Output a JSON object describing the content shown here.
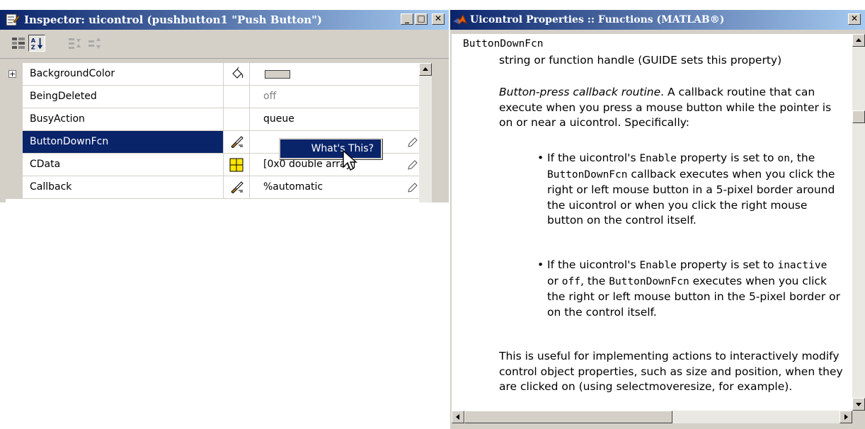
{
  "inspector": {
    "title": "Inspector: uicontrol (pushbutton1 \"Push Button\")",
    "minimize_label": "_",
    "maximize_label": "□",
    "close_label": "✕",
    "expand_label": "+",
    "rows": [
      {
        "name": "BackgroundColor",
        "value": ""
      },
      {
        "name": "BeingDeleted",
        "value": "off"
      },
      {
        "name": "BusyAction",
        "value": "queue"
      },
      {
        "name": "ButtonDownFcn",
        "value": ""
      },
      {
        "name": "CData",
        "value": "[0x0 double array]"
      },
      {
        "name": "Callback",
        "value": "%automatic"
      }
    ],
    "context_menu_item": "What's This?"
  },
  "help": {
    "title": "Uicontrol Properties :: Functions (MATLAB®)",
    "close_label": "✕",
    "property_name": "ButtonDownFcn",
    "property_type": "string or function handle (GUIDE sets this property)",
    "desc_title": "Button-press callback routine",
    "desc_text": ". A callback routine that can execute when you press a mouse button while the pointer is on or near a uicontrol. Specifically:",
    "b1_pre": "If the uicontrol's ",
    "b1_code1": "Enable",
    "b1_mid1": " property is set to ",
    "b1_code2": "on",
    "b1_mid2": ", the ",
    "b1_code3": "ButtonDownFcn",
    "b1_post": " callback executes when you click the right or left mouse button in a 5-pixel border around the uicontrol or when you click the right mouse button on the control itself.",
    "b2_pre": "If the uicontrol's ",
    "b2_code1": "Enable",
    "b2_mid1": " property is set to ",
    "b2_code2": "inactive",
    "b2_mid2": " or ",
    "b2_code3": "off",
    "b2_mid3": ", the ",
    "b2_code4": "ButtonDownFcn",
    "b2_post": " executes when you click the right or left mouse button in the 5-pixel border or on the control itself.",
    "footer_pre": "This is useful for implementing actions to interactively modify control object properties, such as size and position, when they are clicked on (using ",
    "footer_code": "selectmoveresize",
    "footer_post": ", for example)."
  },
  "colors": {
    "titlebar_active": "#0a246a",
    "selection": "#0a246a",
    "window_face": "#d4d0c8"
  },
  "icons": [
    "inspector-icon",
    "categorized-icon",
    "alphabetical-icon",
    "expand-all-icon",
    "collapse-all-icon",
    "paint-bucket-icon",
    "callback-editor-icon",
    "color-grid-icon",
    "pencil-icon",
    "matlab-logo-icon"
  ]
}
